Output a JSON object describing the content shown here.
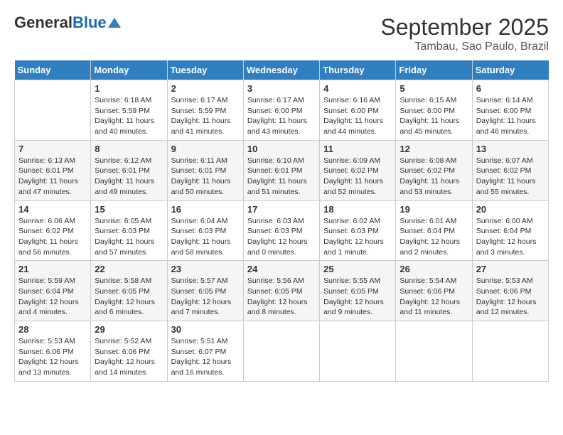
{
  "header": {
    "logo_general": "General",
    "logo_blue": "Blue",
    "month": "September 2025",
    "location": "Tambau, Sao Paulo, Brazil"
  },
  "weekdays": [
    "Sunday",
    "Monday",
    "Tuesday",
    "Wednesday",
    "Thursday",
    "Friday",
    "Saturday"
  ],
  "weeks": [
    [
      {
        "day": "",
        "info": ""
      },
      {
        "day": "1",
        "info": "Sunrise: 6:18 AM\nSunset: 5:59 PM\nDaylight: 11 hours\nand 40 minutes."
      },
      {
        "day": "2",
        "info": "Sunrise: 6:17 AM\nSunset: 5:59 PM\nDaylight: 11 hours\nand 41 minutes."
      },
      {
        "day": "3",
        "info": "Sunrise: 6:17 AM\nSunset: 6:00 PM\nDaylight: 11 hours\nand 43 minutes."
      },
      {
        "day": "4",
        "info": "Sunrise: 6:16 AM\nSunset: 6:00 PM\nDaylight: 11 hours\nand 44 minutes."
      },
      {
        "day": "5",
        "info": "Sunrise: 6:15 AM\nSunset: 6:00 PM\nDaylight: 11 hours\nand 45 minutes."
      },
      {
        "day": "6",
        "info": "Sunrise: 6:14 AM\nSunset: 6:00 PM\nDaylight: 11 hours\nand 46 minutes."
      }
    ],
    [
      {
        "day": "7",
        "info": "Sunrise: 6:13 AM\nSunset: 6:01 PM\nDaylight: 11 hours\nand 47 minutes."
      },
      {
        "day": "8",
        "info": "Sunrise: 6:12 AM\nSunset: 6:01 PM\nDaylight: 11 hours\nand 49 minutes."
      },
      {
        "day": "9",
        "info": "Sunrise: 6:11 AM\nSunset: 6:01 PM\nDaylight: 11 hours\nand 50 minutes."
      },
      {
        "day": "10",
        "info": "Sunrise: 6:10 AM\nSunset: 6:01 PM\nDaylight: 11 hours\nand 51 minutes."
      },
      {
        "day": "11",
        "info": "Sunrise: 6:09 AM\nSunset: 6:02 PM\nDaylight: 11 hours\nand 52 minutes."
      },
      {
        "day": "12",
        "info": "Sunrise: 6:08 AM\nSunset: 6:02 PM\nDaylight: 11 hours\nand 53 minutes."
      },
      {
        "day": "13",
        "info": "Sunrise: 6:07 AM\nSunset: 6:02 PM\nDaylight: 11 hours\nand 55 minutes."
      }
    ],
    [
      {
        "day": "14",
        "info": "Sunrise: 6:06 AM\nSunset: 6:02 PM\nDaylight: 11 hours\nand 56 minutes."
      },
      {
        "day": "15",
        "info": "Sunrise: 6:05 AM\nSunset: 6:03 PM\nDaylight: 11 hours\nand 57 minutes."
      },
      {
        "day": "16",
        "info": "Sunrise: 6:04 AM\nSunset: 6:03 PM\nDaylight: 11 hours\nand 58 minutes."
      },
      {
        "day": "17",
        "info": "Sunrise: 6:03 AM\nSunset: 6:03 PM\nDaylight: 12 hours\nand 0 minutes."
      },
      {
        "day": "18",
        "info": "Sunrise: 6:02 AM\nSunset: 6:03 PM\nDaylight: 12 hours\nand 1 minute."
      },
      {
        "day": "19",
        "info": "Sunrise: 6:01 AM\nSunset: 6:04 PM\nDaylight: 12 hours\nand 2 minutes."
      },
      {
        "day": "20",
        "info": "Sunrise: 6:00 AM\nSunset: 6:04 PM\nDaylight: 12 hours\nand 3 minutes."
      }
    ],
    [
      {
        "day": "21",
        "info": "Sunrise: 5:59 AM\nSunset: 6:04 PM\nDaylight: 12 hours\nand 4 minutes."
      },
      {
        "day": "22",
        "info": "Sunrise: 5:58 AM\nSunset: 6:05 PM\nDaylight: 12 hours\nand 6 minutes."
      },
      {
        "day": "23",
        "info": "Sunrise: 5:57 AM\nSunset: 6:05 PM\nDaylight: 12 hours\nand 7 minutes."
      },
      {
        "day": "24",
        "info": "Sunrise: 5:56 AM\nSunset: 6:05 PM\nDaylight: 12 hours\nand 8 minutes."
      },
      {
        "day": "25",
        "info": "Sunrise: 5:55 AM\nSunset: 6:05 PM\nDaylight: 12 hours\nand 9 minutes."
      },
      {
        "day": "26",
        "info": "Sunrise: 5:54 AM\nSunset: 6:06 PM\nDaylight: 12 hours\nand 11 minutes."
      },
      {
        "day": "27",
        "info": "Sunrise: 5:53 AM\nSunset: 6:06 PM\nDaylight: 12 hours\nand 12 minutes."
      }
    ],
    [
      {
        "day": "28",
        "info": "Sunrise: 5:53 AM\nSunset: 6:06 PM\nDaylight: 12 hours\nand 13 minutes."
      },
      {
        "day": "29",
        "info": "Sunrise: 5:52 AM\nSunset: 6:06 PM\nDaylight: 12 hours\nand 14 minutes."
      },
      {
        "day": "30",
        "info": "Sunrise: 5:51 AM\nSunset: 6:07 PM\nDaylight: 12 hours\nand 16 minutes."
      },
      {
        "day": "",
        "info": ""
      },
      {
        "day": "",
        "info": ""
      },
      {
        "day": "",
        "info": ""
      },
      {
        "day": "",
        "info": ""
      }
    ]
  ]
}
